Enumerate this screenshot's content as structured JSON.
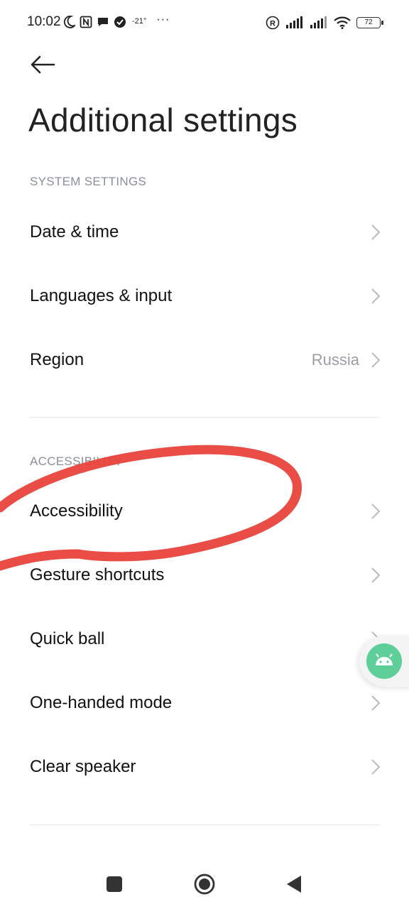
{
  "status_bar": {
    "time": "10:02",
    "temperature": "-21°",
    "more": "···",
    "battery": "72"
  },
  "header": {
    "back_icon": "arrow-left-icon",
    "title": "Additional settings"
  },
  "sections": [
    {
      "header": "SYSTEM SETTINGS",
      "items": [
        {
          "label": "Date & time",
          "value": ""
        },
        {
          "label": "Languages & input",
          "value": ""
        },
        {
          "label": "Region",
          "value": "Russia"
        }
      ]
    },
    {
      "header": "ACCESSIBILITY",
      "items": [
        {
          "label": "Accessibility",
          "value": ""
        },
        {
          "label": "Gesture shortcuts",
          "value": ""
        },
        {
          "label": "Quick ball",
          "value": ""
        },
        {
          "label": "One-handed mode",
          "value": ""
        },
        {
          "label": "Clear speaker",
          "value": ""
        }
      ]
    }
  ],
  "colors": {
    "annotation": "#e8433c",
    "floating_ball": "#5fcf9a"
  },
  "nav_bar": {
    "recents_icon": "square-icon",
    "home_icon": "circle-icon",
    "back_icon": "triangle-back-icon"
  }
}
